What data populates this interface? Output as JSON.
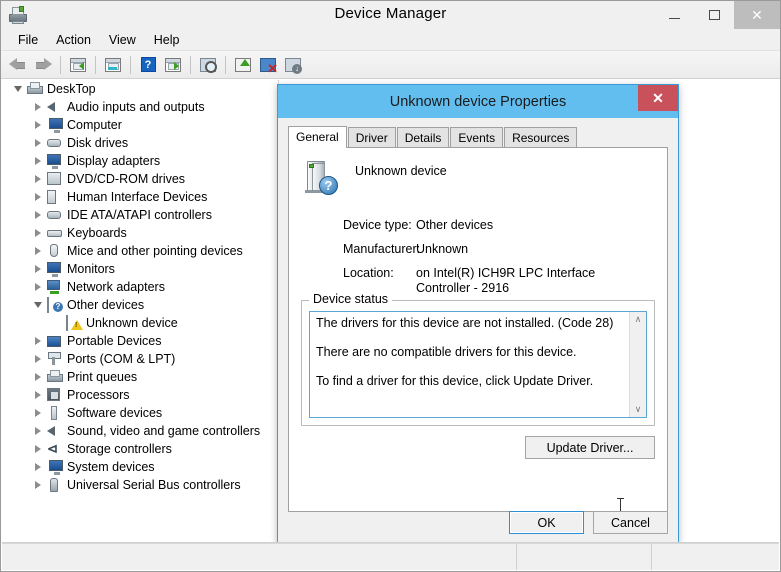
{
  "window": {
    "title": "Device Manager",
    "icon": "printer-icon",
    "controls": {
      "minimize": "–",
      "maximize": "☐",
      "close": "✕"
    }
  },
  "menubar": {
    "items": [
      "File",
      "Action",
      "View",
      "Help"
    ]
  },
  "toolbar": {
    "buttons": [
      "back-arrow-icon",
      "forward-arrow-icon",
      "properties-icon",
      "show-hidden-icon",
      "help-icon",
      "scan-view-icon",
      "scan-hardware-changes-icon",
      "update-driver-icon",
      "disable-device-icon",
      "uninstall-device-icon"
    ]
  },
  "tree": {
    "root": {
      "label": "DeskTop",
      "icon": "computer-printer-icon",
      "expanded": true
    },
    "items": [
      {
        "label": "Audio inputs and outputs",
        "icon": "speaker-icon",
        "expanded": false,
        "level": 1
      },
      {
        "label": "Computer",
        "icon": "computer-icon",
        "expanded": false,
        "level": 1
      },
      {
        "label": "Disk drives",
        "icon": "disk-icon",
        "expanded": false,
        "level": 1
      },
      {
        "label": "Display adapters",
        "icon": "monitor-icon",
        "expanded": false,
        "level": 1
      },
      {
        "label": "DVD/CD-ROM drives",
        "icon": "optical-drive-icon",
        "expanded": false,
        "level": 1
      },
      {
        "label": "Human Interface Devices",
        "icon": "hid-icon",
        "expanded": false,
        "level": 1
      },
      {
        "label": "IDE ATA/ATAPI controllers",
        "icon": "ide-controller-icon",
        "expanded": false,
        "level": 1
      },
      {
        "label": "Keyboards",
        "icon": "keyboard-icon",
        "expanded": false,
        "level": 1
      },
      {
        "label": "Mice and other pointing devices",
        "icon": "mouse-icon",
        "expanded": false,
        "level": 1
      },
      {
        "label": "Monitors",
        "icon": "monitor-icon",
        "expanded": false,
        "level": 1
      },
      {
        "label": "Network adapters",
        "icon": "network-adapter-icon",
        "expanded": false,
        "level": 1
      },
      {
        "label": "Other devices",
        "icon": "unknown-device-icon",
        "expanded": true,
        "level": 1
      },
      {
        "label": "Unknown device",
        "icon": "unknown-device-warning-icon",
        "expanded": null,
        "level": 2,
        "selected": false
      },
      {
        "label": "Portable Devices",
        "icon": "portable-device-icon",
        "expanded": false,
        "level": 1
      },
      {
        "label": "Ports (COM & LPT)",
        "icon": "port-icon",
        "expanded": false,
        "level": 1
      },
      {
        "label": "Print queues",
        "icon": "printer-icon",
        "expanded": false,
        "level": 1
      },
      {
        "label": "Processors",
        "icon": "processor-icon",
        "expanded": false,
        "level": 1
      },
      {
        "label": "Software devices",
        "icon": "software-device-icon",
        "expanded": false,
        "level": 1
      },
      {
        "label": "Sound, video and game controllers",
        "icon": "speaker-icon",
        "expanded": false,
        "level": 1
      },
      {
        "label": "Storage controllers",
        "icon": "storage-controller-icon",
        "expanded": false,
        "level": 1
      },
      {
        "label": "System devices",
        "icon": "computer-icon",
        "expanded": false,
        "level": 1
      },
      {
        "label": "Universal Serial Bus controllers",
        "icon": "usb-icon",
        "expanded": false,
        "level": 1
      }
    ]
  },
  "dialog": {
    "title": "Unknown device Properties",
    "close_label": "✕",
    "tabs": [
      {
        "label": "General",
        "active": true
      },
      {
        "label": "Driver",
        "active": false
      },
      {
        "label": "Details",
        "active": false
      },
      {
        "label": "Events",
        "active": false
      },
      {
        "label": "Resources",
        "active": false
      }
    ],
    "general": {
      "device_name": "Unknown device",
      "device_icon": "unknown-device-question-icon",
      "fields": [
        {
          "label": "Device type:",
          "value": "Other devices"
        },
        {
          "label": "Manufacturer:",
          "value": "Unknown"
        },
        {
          "label": "Location:",
          "value": "on Intel(R) ICH9R LPC Interface Controller - 2916"
        }
      ],
      "status_group_label": "Device status",
      "status_lines": [
        "The drivers for this device are not installed. (Code 28)",
        "There are no compatible drivers for this device.",
        "To find a driver for this device, click Update Driver."
      ],
      "scrollbar": {
        "up": "∧",
        "down": "∨"
      },
      "update_driver_label": "Update Driver..."
    },
    "footer": {
      "ok_label": "OK",
      "cancel_label": "Cancel"
    }
  },
  "statusbar": {
    "panes": [
      "",
      "",
      ""
    ]
  },
  "colors": {
    "dialog_title_bg": "#63bef0",
    "dialog_close_bg": "#c9515b",
    "focus_border": "#2d8fd5",
    "status_field_border": "#5aa7d8",
    "window_bg": "#f0f0f0"
  }
}
